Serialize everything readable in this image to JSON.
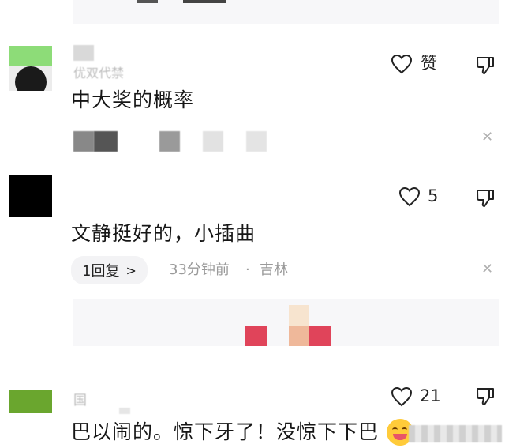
{
  "comments": [
    {
      "avatar_color": "#7fd76c",
      "username": "优双代禁",
      "likes_label": "赞",
      "text": "中大奖的概率"
    },
    {
      "avatar_color": "#000000",
      "likes_count": "5",
      "text": "文静挺好的，小插曲",
      "replies_label": "1回复",
      "time": "33分钟前",
      "dot": "·",
      "location": "吉林"
    },
    {
      "avatar_color": "#6aa62e",
      "username": "国",
      "likes_count": "21",
      "text": "巴以闹的。惊下牙了！没惊下下巴"
    }
  ],
  "close_glyph": "✕",
  "colors": {
    "pink_tile": "#e0445a",
    "peach_tile": "#f0c8a8",
    "grey_text": "#9a9a9a"
  }
}
